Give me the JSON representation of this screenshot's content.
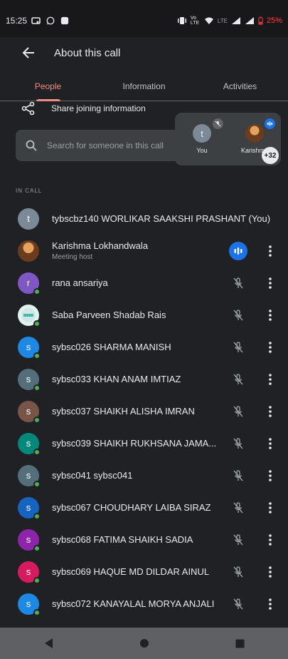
{
  "status_bar": {
    "time": "15:25",
    "network": "Vo LTE",
    "lte": "LTE",
    "battery": "25%"
  },
  "app_bar": {
    "title": "About this call",
    "back_icon": "arrow-back-icon"
  },
  "tabs": [
    {
      "label": "People",
      "active": true
    },
    {
      "label": "Information",
      "active": false
    },
    {
      "label": "Activities",
      "active": false
    }
  ],
  "share": {
    "label": "Share joining information",
    "icon": "share-icon"
  },
  "search": {
    "placeholder": "Search for someone in this call",
    "icon": "search-icon"
  },
  "pip": {
    "tiles": [
      {
        "name": "You",
        "initial": "t",
        "color": "#7b8a96"
      },
      {
        "name": "Karishma",
        "initial": "",
        "color": "#c47a3a"
      }
    ],
    "more_count": "+32"
  },
  "section_label": "IN CALL",
  "people": [
    {
      "name": "tybscbz140 WORLIKAR SAAKSHI PRASHANT (You)",
      "initial": "t",
      "color": "#7b8a96",
      "online": false,
      "mic": "none",
      "menu": false
    },
    {
      "name": "Karishma Lokhandwala",
      "subtitle": "Meeting host",
      "initial": "",
      "color": "#b8733a",
      "online": false,
      "mic": "active",
      "menu": true,
      "photo": true
    },
    {
      "name": "rana ansariya",
      "initial": "r",
      "color": "#7e57c2",
      "online": true,
      "mic": "muted",
      "menu": true
    },
    {
      "name": "Saba Parveen Shadab Rais",
      "initial": "",
      "color": "#e0f2f1",
      "online": true,
      "mic": "muted",
      "menu": true,
      "photo": true
    },
    {
      "name": "sybsc026 SHARMA MANISH",
      "initial": "s",
      "color": "#1e88e5",
      "online": true,
      "mic": "muted",
      "menu": true
    },
    {
      "name": "sybsc033 KHAN ANAM IMTIAZ",
      "initial": "s",
      "color": "#546e7a",
      "online": true,
      "mic": "muted",
      "menu": true
    },
    {
      "name": "sybsc037 SHAIKH ALISHA IMRAN",
      "initial": "s",
      "color": "#795548",
      "online": true,
      "mic": "muted",
      "menu": true
    },
    {
      "name": "sybsc039 SHAIKH RUKHSANA JAMA...",
      "initial": "s",
      "color": "#00897b",
      "online": true,
      "mic": "muted",
      "menu": true
    },
    {
      "name": "sybsc041 sybsc041",
      "initial": "s",
      "color": "#546e7a",
      "online": true,
      "mic": "muted",
      "menu": true
    },
    {
      "name": "sybsc067 CHOUDHARY LAIBA SIRAZ",
      "initial": "s",
      "color": "#1565c0",
      "online": true,
      "mic": "muted",
      "menu": true
    },
    {
      "name": "sybsc068 FATIMA SHAIKH SADIA",
      "initial": "s",
      "color": "#8e24aa",
      "online": true,
      "mic": "muted",
      "menu": true
    },
    {
      "name": "sybsc069 HAQUE MD DILDAR AINUL",
      "initial": "s",
      "color": "#d81b60",
      "online": true,
      "mic": "muted",
      "menu": true
    },
    {
      "name": "sybsc072 KANAYALAL MORYA ANJALI",
      "initial": "s",
      "color": "#1e88e5",
      "online": true,
      "mic": "muted",
      "menu": true
    }
  ],
  "nav_bar": {
    "back": "nav-back-icon",
    "home": "nav-home-icon",
    "recents": "nav-recents-icon"
  }
}
